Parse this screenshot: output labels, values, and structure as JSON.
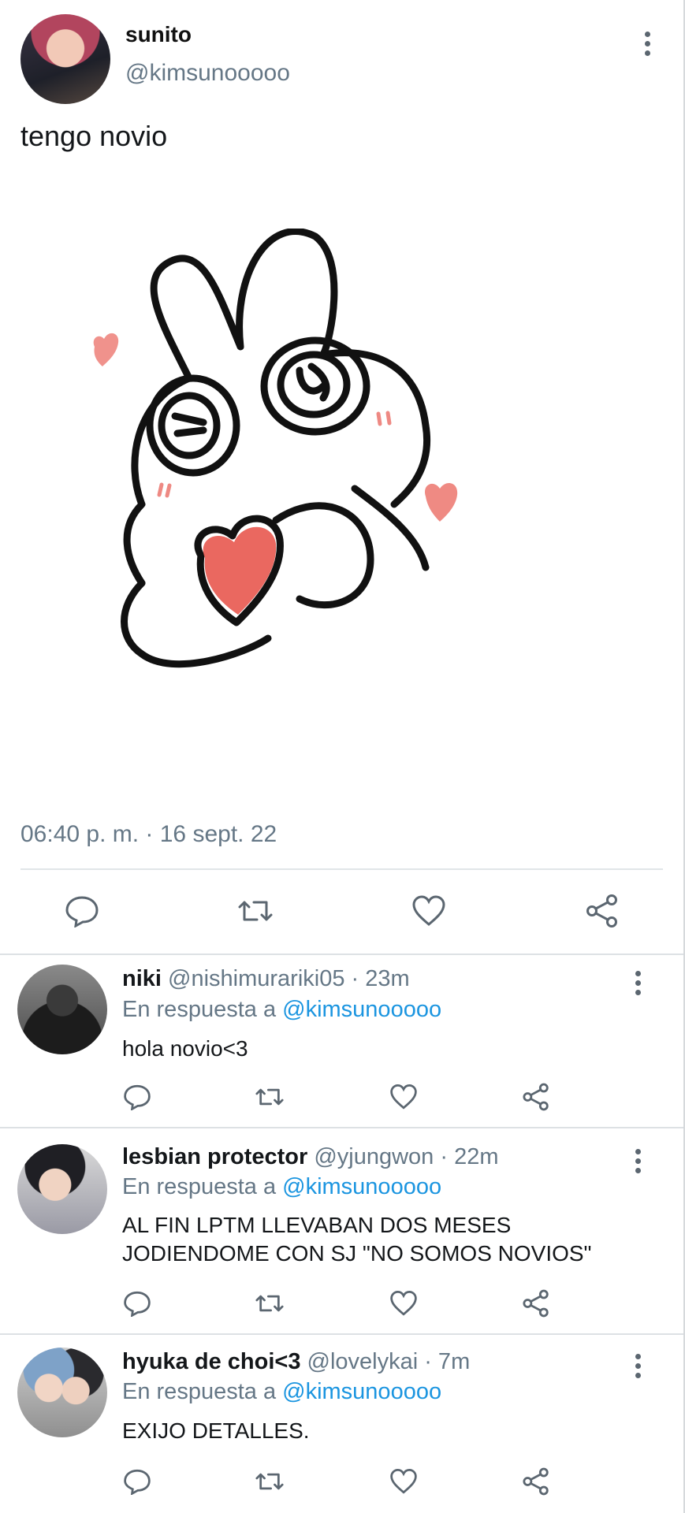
{
  "main_tweet": {
    "author_name": "sunito",
    "author_handle": "@kimsunooooo",
    "text": "tengo novio",
    "timestamp": "06:40 p. m. · 16 sept. 22",
    "actions": [
      "comment-icon",
      "retweet-icon",
      "heart-icon",
      "share-icon"
    ]
  },
  "replies": [
    {
      "name": "niki",
      "meta": " @nishimurariki05 · 23m",
      "reply_prefix": "En respuesta a ",
      "mention": "@kimsunooooo",
      "text_line1": "hola novio<3",
      "text_line2": ""
    },
    {
      "name": "lesbian protector",
      "meta": " @yjungwon · 22m",
      "reply_prefix": "En respuesta a ",
      "mention": "@kimsunooooo",
      "text_line1": "AL FIN LPTM LLEVABAN DOS MESES",
      "text_line2": "JODIENDOME CON SJ \"NO SOMOS NOVIOS\""
    },
    {
      "name": "hyuka de choi<3",
      "meta": " @lovelykai · 7m",
      "reply_prefix": "En respuesta a ",
      "mention": "@kimsunooooo",
      "text_line1": "EXIJO DETALLES.",
      "text_line2": ""
    }
  ],
  "colors": {
    "link": "#1b95e0",
    "secondary_text": "#657786",
    "icon": "#5b6670",
    "heart": "#e8584f"
  }
}
